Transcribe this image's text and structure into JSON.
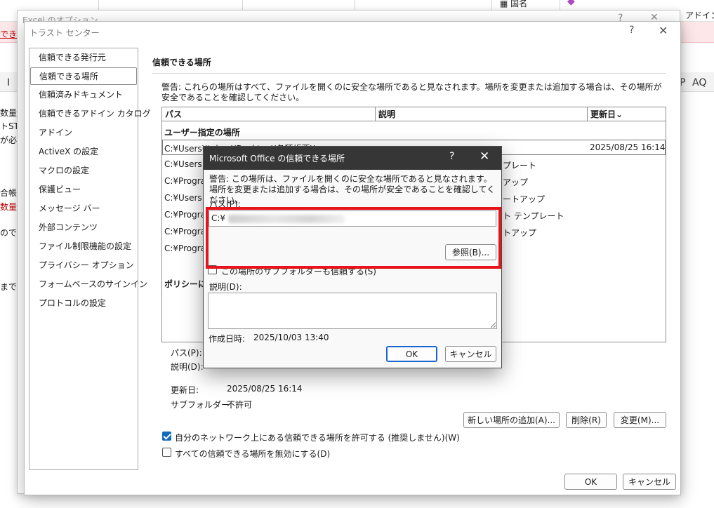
{
  "background": {
    "ribbon_labels": [
      "国名",
      "アドイン"
    ],
    "options_title": "Excel のオプション",
    "options_controls": [
      "?",
      "✕"
    ],
    "red_band_text": "でき",
    "column_letters": [
      "I",
      "P",
      "AQ"
    ],
    "left_fragments": [
      "数量",
      "トST",
      "が必",
      "合帳",
      "数量",
      "ので",
      "までこ"
    ]
  },
  "trust_center": {
    "title": "トラスト センター",
    "help": "?",
    "close": "✕",
    "nav_items": [
      "信頼できる発行元",
      "信頼できる場所",
      "信頼済みドキュメント",
      "信頼できるアドイン カタログ",
      "アドイン",
      "ActiveX の設定",
      "マクロの設定",
      "保護ビュー",
      "メッセージ バー",
      "外部コンテンツ",
      "ファイル制限機能の設定",
      "プライバシー オプション",
      "フォームベースのサインイン",
      "プロトコルの設定"
    ],
    "section_title": "信頼できる場所",
    "warning": "警告: これらの場所はすべて、ファイルを開くのに安全な場所であると見なされます。場所を変更または追加する場合は、その場所が安全であることを確認してください。",
    "table": {
      "headers": [
        "パス",
        "説明",
        "更新日⌄"
      ],
      "user_section": "ユーザー指定の場所",
      "rows": [
        {
          "path": "C:¥Users¥takao¥Desktop¥各種帳票¥",
          "desc": "",
          "date": "2025/08/25 16:14"
        },
        {
          "path": "C:¥Users",
          "desc": "プレート",
          "date": ""
        },
        {
          "path": "C:¥Progra",
          "desc": "アップ",
          "date": ""
        },
        {
          "path": "C:¥Users",
          "desc": "ートアップ",
          "date": ""
        },
        {
          "path": "C:¥Progra",
          "desc": "ト テンプレート",
          "date": ""
        },
        {
          "path": "C:¥Progra",
          "desc": "トアップ",
          "date": ""
        },
        {
          "path": "C:¥Progra",
          "desc": "",
          "date": ""
        }
      ],
      "policy_section": "ポリシーによ"
    },
    "detail": {
      "path_label": "パス(P):",
      "desc_label": "説明(D):",
      "updated_label": "更新日:",
      "updated_value": "2025/08/25 16:14",
      "subfolder_label": "サブフォルダー:",
      "subfolder_value": "不許可"
    },
    "buttons": {
      "add": "新しい場所の追加(A)...",
      "remove": "削除(R)",
      "modify": "変更(M)...",
      "ok": "OK",
      "cancel": "キャンセル"
    },
    "checkbox_network": "自分のネットワーク上にある信頼できる場所を許可する (推奨しません)(W)",
    "checkbox_disable": "すべての信頼できる場所を無効にする(D)"
  },
  "modal": {
    "title": "Microsoft Office の信頼できる場所",
    "help": "?",
    "close": "✕",
    "warning": "警告: この場所は、ファイルを開くのに安全な場所であると見なされます。場所を変更または追加する場合は、その場所が安全であることを確認してください。",
    "path_label": "パス(P):",
    "path_value": "C:¥",
    "browse": "参照(B)...",
    "subfolder_checkbox": "この場所のサブフォルダーも信頼する(S)",
    "desc_label": "説明(D):",
    "created_label": "作成日時:",
    "created_value": "2025/10/03 13:40",
    "ok": "OK",
    "cancel": "キャンセル"
  },
  "colors": {
    "highlight": "#e8141c",
    "modal_titlebar": "#363636",
    "checkbox_on": "#0f6cbd",
    "primary_border": "#1b66c9"
  }
}
